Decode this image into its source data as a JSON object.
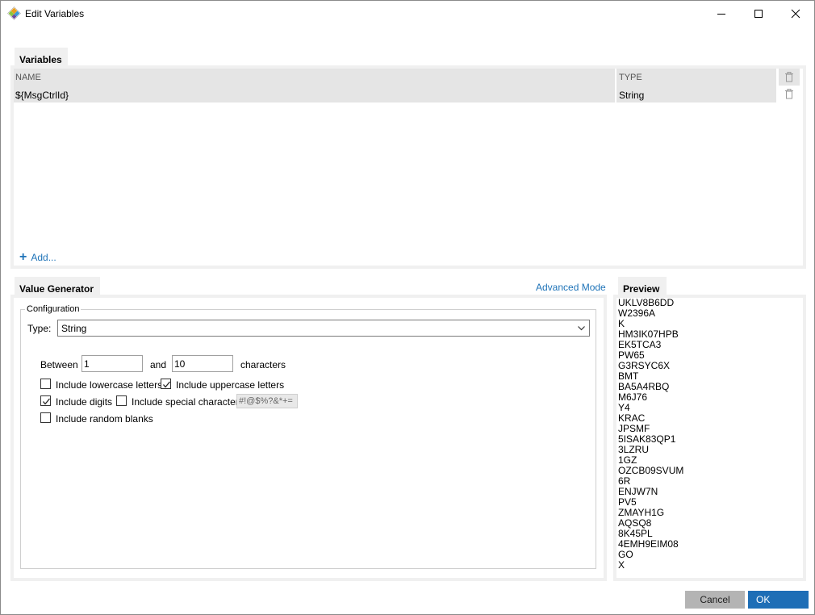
{
  "window": {
    "title": "Edit Variables"
  },
  "variables": {
    "section_label": "Variables",
    "columns": {
      "name": "NAME",
      "type": "TYPE"
    },
    "rows": [
      {
        "name": "${MsgCtrlId}",
        "type": "String"
      }
    ],
    "add_label": "Add..."
  },
  "generator": {
    "section_label": "Value Generator",
    "advanced_mode_label": "Advanced Mode",
    "configuration_label": "Configuration",
    "type_label": "Type:",
    "type_value": "String",
    "between_label": "Between",
    "min_value": "1",
    "and_label": "and",
    "max_value": "10",
    "characters_label": "characters",
    "options": {
      "lowercase": {
        "label": "Include lowercase letters",
        "checked": false
      },
      "uppercase": {
        "label": "Include uppercase letters",
        "checked": true
      },
      "digits": {
        "label": "Include digits",
        "checked": true
      },
      "special": {
        "label": "Include special characters",
        "checked": false
      },
      "blanks": {
        "label": "Include random blanks",
        "checked": false
      }
    },
    "special_chars_value": "#!@$%?&*+="
  },
  "preview": {
    "section_label": "Preview",
    "items": [
      "UKLV8B6DD",
      "W2396A",
      "K",
      "HM3IK07HPB",
      "EK5TCA3",
      "PW65",
      "G3RSYC6X",
      "BMT",
      "BA5A4RBQ",
      "M6J76",
      "Y4",
      "KRAC",
      "JPSMF",
      "5ISAK83QP1",
      "3LZRU",
      "1GZ",
      "OZCB09SVUM",
      "6R",
      "ENJW7N",
      "PV5",
      "ZMAYH1G",
      "AQSQ8",
      "8K45PL",
      "4EMH9EIM08",
      "GO",
      "X"
    ]
  },
  "footer": {
    "cancel_label": "Cancel",
    "ok_label": "OK"
  },
  "colors": {
    "link": "#1e73b8",
    "ok_button": "#1e6eb6",
    "cancel_button": "#b4b4b4",
    "panel_background": "#f0f0f0",
    "grid_row": "#e5e5e5"
  }
}
